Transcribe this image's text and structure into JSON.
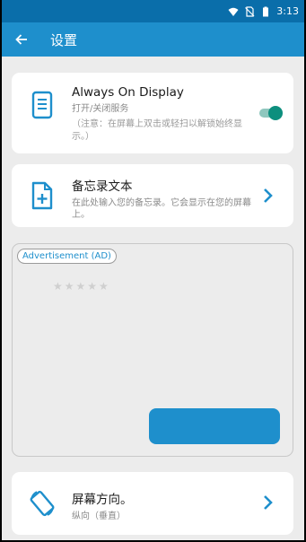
{
  "statusbar": {
    "time": "3:13"
  },
  "appbar": {
    "title": "设置"
  },
  "aod": {
    "title": "Always On Display",
    "subtitle": "打开/关闭服务",
    "note": "（注意：在屏幕上双击或轻扫以解锁始终显示。）",
    "enabled": true
  },
  "memo": {
    "title": "备忘录文本",
    "subtitle": "在此处输入您的备忘录。它会显示在您的屏幕上。"
  },
  "ad": {
    "badge": "Advertisement (AD)",
    "stars": "★★★★★",
    "rating": 0
  },
  "orientation": {
    "title": "屏幕方向。",
    "subtitle": "纵向（垂直）"
  },
  "colors": {
    "statusbar": "#0a6eaa",
    "appbar": "#1e8fcc",
    "accent": "#1e8fcc",
    "toggle": "#0d8f7e"
  }
}
